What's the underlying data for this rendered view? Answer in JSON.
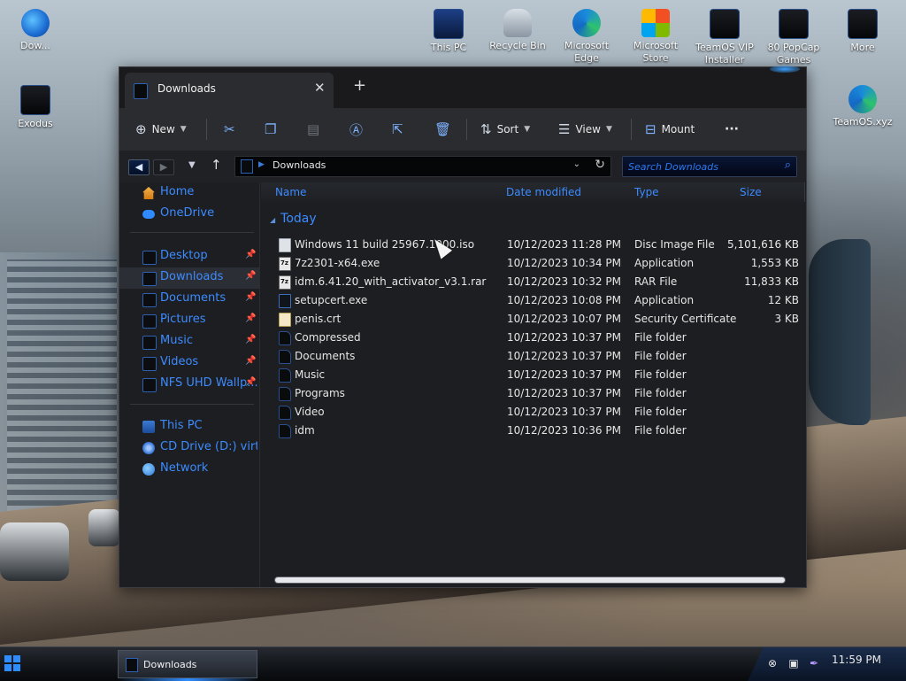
{
  "desktop": {
    "icons": [
      {
        "label": "Dow..."
      },
      {
        "label": "Exodus"
      },
      {
        "label": "This PC"
      },
      {
        "label": "Recycle Bin"
      },
      {
        "label": "Microsoft Edge"
      },
      {
        "label": "Microsoft Store"
      },
      {
        "label": "TeamOS VIP Installer"
      },
      {
        "label": "80 PopCap Games"
      },
      {
        "label": "More"
      },
      {
        "label": "TeamOS.xyz"
      }
    ]
  },
  "window": {
    "tab_title": "Downloads",
    "toolbar": {
      "new_label": "New",
      "sort_label": "Sort",
      "view_label": "View",
      "mount_label": "Mount",
      "more_label": "···"
    },
    "address": {
      "path": "Downloads",
      "search_placeholder": "Search Downloads"
    },
    "nav": {
      "quick": [
        "Home",
        "OneDrive"
      ],
      "pinned": [
        "Desktop",
        "Downloads",
        "Documents",
        "Pictures",
        "Music",
        "Videos",
        "NFS UHD Wallp..."
      ],
      "devices": [
        "This PC",
        "CD Drive (D:) virtio-",
        "Network"
      ]
    },
    "columns": [
      "Name",
      "Date modified",
      "Type",
      "Size"
    ],
    "group_label": "Today",
    "files": [
      {
        "name": "Windows 11 build 25967.1000.iso",
        "date": "10/12/2023 11:28 PM",
        "type": "Disc Image File",
        "size": "5,101,616 KB",
        "icon": "iso"
      },
      {
        "name": "7z2301-x64.exe",
        "date": "10/12/2023 10:34 PM",
        "type": "Application",
        "size": "1,553 KB",
        "icon": "7z"
      },
      {
        "name": "idm.6.41.20_with_activator_v3.1.rar",
        "date": "10/12/2023 10:32 PM",
        "type": "RAR File",
        "size": "11,833 KB",
        "icon": "7z"
      },
      {
        "name": "setupcert.exe",
        "date": "10/12/2023 10:08 PM",
        "type": "Application",
        "size": "12 KB",
        "icon": "exe"
      },
      {
        "name": "penis.crt",
        "date": "10/12/2023 10:07 PM",
        "type": "Security Certificate",
        "size": "3 KB",
        "icon": "crt"
      },
      {
        "name": "Compressed",
        "date": "10/12/2023 10:37 PM",
        "type": "File folder",
        "size": "",
        "icon": "folder"
      },
      {
        "name": "Documents",
        "date": "10/12/2023 10:37 PM",
        "type": "File folder",
        "size": "",
        "icon": "folder"
      },
      {
        "name": "Music",
        "date": "10/12/2023 10:37 PM",
        "type": "File folder",
        "size": "",
        "icon": "folder"
      },
      {
        "name": "Programs",
        "date": "10/12/2023 10:37 PM",
        "type": "File folder",
        "size": "",
        "icon": "folder"
      },
      {
        "name": "Video",
        "date": "10/12/2023 10:37 PM",
        "type": "File folder",
        "size": "",
        "icon": "folder"
      },
      {
        "name": "idm",
        "date": "10/12/2023 10:36 PM",
        "type": "File folder",
        "size": "",
        "icon": "folder"
      }
    ]
  },
  "taskbar": {
    "task_label": "Downloads",
    "clock": "11:59 PM"
  },
  "colors": {
    "accent": "#3d8bff",
    "window_bg": "#1c1e21",
    "toolbar_bg": "#2a2c30"
  }
}
